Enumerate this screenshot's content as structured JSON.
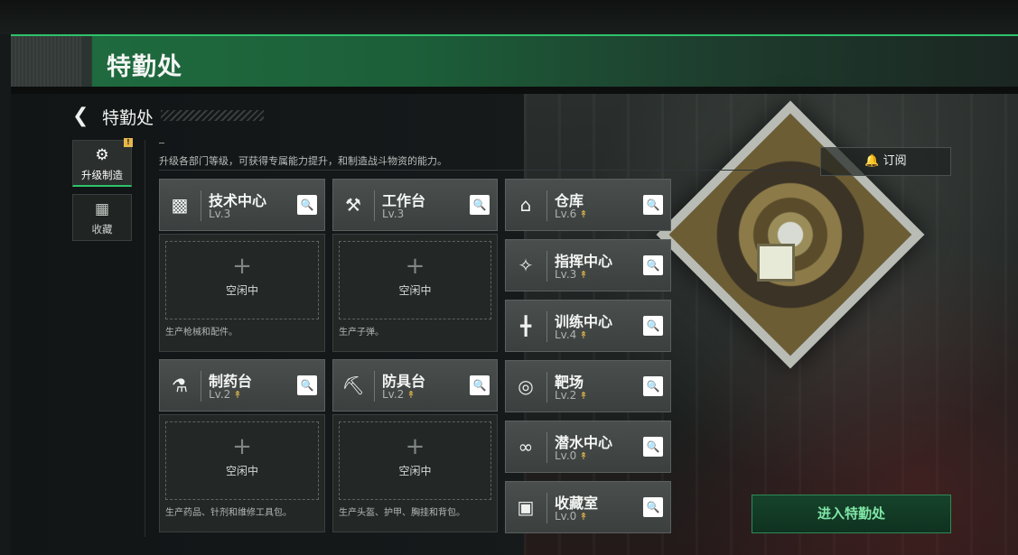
{
  "banner": {
    "title": "特勤处"
  },
  "panel": {
    "back_icon": "back-arrow-icon",
    "title": "特勤处"
  },
  "side_tabs": [
    {
      "label": "升级制造",
      "icon": "upgrade-build-icon",
      "active": true,
      "badge": "!"
    },
    {
      "label": "收藏",
      "icon": "collection-icon",
      "active": false
    }
  ],
  "description": "升级各部门等级，可获得专属能力提升，和制造战斗物资的能力。",
  "subscribe": {
    "label": "订阅",
    "icon": "bell-icon"
  },
  "departments": [
    {
      "name": "技术中心",
      "level": "Lv.3",
      "icon": "tech-center-icon"
    },
    {
      "name": "工作台",
      "level": "Lv.3",
      "icon": "workbench-icon"
    },
    {
      "name": "仓库",
      "level": "Lv.6",
      "icon": "warehouse-icon",
      "upgradable": true
    },
    {
      "name": "指挥中心",
      "level": "Lv.3",
      "icon": "command-center-icon",
      "upgradable": true
    },
    {
      "name": "训练中心",
      "level": "Lv.4",
      "icon": "training-center-icon",
      "upgradable": true
    },
    {
      "name": "制药台",
      "level": "Lv.2",
      "icon": "pharmacy-icon",
      "upgradable": true
    },
    {
      "name": "防具台",
      "level": "Lv.2",
      "icon": "armor-bench-icon",
      "upgradable": true
    },
    {
      "name": "靶场",
      "level": "Lv.2",
      "icon": "shooting-range-icon",
      "upgradable": true
    },
    {
      "name": "潜水中心",
      "level": "Lv.0",
      "icon": "diving-center-icon",
      "upgradable": true
    },
    {
      "name": "收藏室",
      "level": "Lv.0",
      "icon": "collection-room-icon",
      "upgradable": true
    }
  ],
  "slots": [
    {
      "status": "空闲中",
      "note": "生产枪械和配件。"
    },
    {
      "status": "空闲中",
      "note": "生产子弹。"
    },
    {
      "status": "空闲中",
      "note": "生产药品、针剂和维修工具包。"
    },
    {
      "status": "空闲中",
      "note": "生产头盔、护甲、胸挂和背包。"
    }
  ],
  "enter_button": "进入特勤处"
}
